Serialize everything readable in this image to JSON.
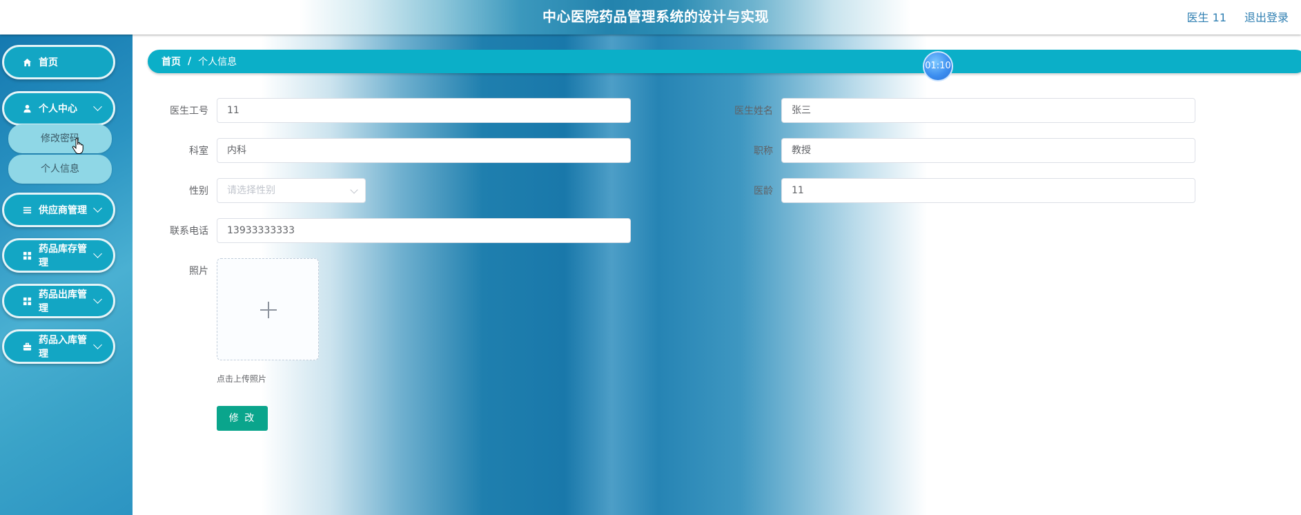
{
  "header": {
    "title": "中心医院药品管理系统的设计与实现",
    "user_label": "医生 11",
    "logout_label": "退出登录"
  },
  "sidebar": {
    "items": [
      {
        "label": "首页",
        "icon": "home-icon"
      },
      {
        "label": "个人中心",
        "icon": "user-icon"
      },
      {
        "label": "供应商管理",
        "icon": "list-icon"
      },
      {
        "label": "药品库存管理",
        "icon": "grid-icon"
      },
      {
        "label": "药品出库管理",
        "icon": "grid-icon"
      },
      {
        "label": "药品入库管理",
        "icon": "briefcase-icon"
      }
    ],
    "submenu": [
      {
        "label": "修改密码"
      },
      {
        "label": "个人信息"
      }
    ]
  },
  "breadcrumb": {
    "home": "首页",
    "separator": "/",
    "current": "个人信息"
  },
  "timer": "01:10",
  "form": {
    "doctor_id": {
      "label": "医生工号",
      "value": "11"
    },
    "doctor_name": {
      "label": "医生姓名",
      "value": "张三"
    },
    "department": {
      "label": "科室",
      "value": "内科"
    },
    "title": {
      "label": "职称",
      "value": "教授"
    },
    "gender": {
      "label": "性别",
      "placeholder": "请选择性别"
    },
    "years": {
      "label": "医龄",
      "value": "11"
    },
    "phone": {
      "label": "联系电话",
      "value": "13933333333"
    },
    "photo": {
      "label": "照片",
      "tip": "点击上传照片"
    },
    "submit_label": "修 改"
  },
  "colors": {
    "menu_bg": "#13a6c4",
    "submenu_bg": "#8fd7e6",
    "breadcrumb_bg": "#0bafc8",
    "submit_bg": "#0aa58c",
    "header_text": "#2f7fb2"
  }
}
